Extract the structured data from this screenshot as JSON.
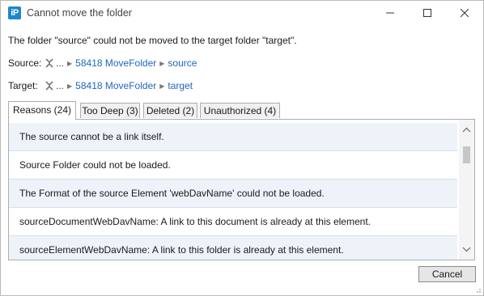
{
  "window": {
    "app_icon_text": "iP",
    "title": "Cannot move the folder"
  },
  "message": "The folder \"source\" could not be moved to the target folder \"target\".",
  "source_path": {
    "label": "Source:",
    "ellipsis": "...",
    "crumbs": [
      "58418 MoveFolder",
      "source"
    ]
  },
  "target_path": {
    "label": "Target:",
    "ellipsis": "...",
    "crumbs": [
      "58418 MoveFolder",
      "target"
    ]
  },
  "tabs": [
    {
      "label": "Reasons (24)",
      "active": true
    },
    {
      "label": "Too Deep (3)",
      "active": false
    },
    {
      "label": "Deleted (2)",
      "active": false
    },
    {
      "label": "Unauthorized (4)",
      "active": false
    }
  ],
  "reasons": [
    "The source cannot be a link itself.",
    "Source Folder could not be loaded.",
    "The Format of the source Element 'webDavName' could not be loaded.",
    "sourceDocumentWebDavName: A link to this document is already at this element.",
    "sourceElementWebDavName: A link to this folder is already at this element."
  ],
  "buttons": {
    "cancel": "Cancel"
  }
}
